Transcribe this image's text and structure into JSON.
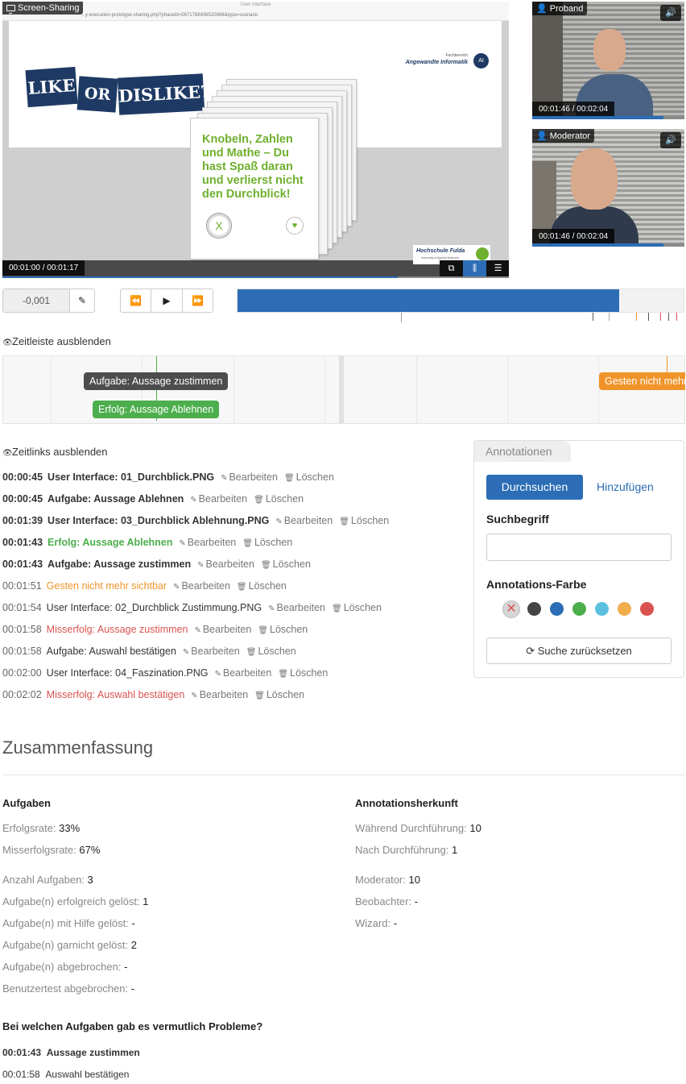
{
  "screen_share": {
    "label": "Screen-Sharing",
    "window_title": "User Interface",
    "url": "...y-execution-prototype-sharing.php?phaseId=5671788436520968&type=scenario",
    "slide": {
      "banner_like": "LIKE",
      "banner_or": "OR",
      "banner_dislike": "DISLIKE?",
      "logo_small": "Fachbereich",
      "logo_name": "Angewandte Informatik",
      "logo_badge": "AI",
      "card_text": "Knobeln, Zahlen und Mathe – Du hast Spaß daran und verlierst nicht den Durchblick!",
      "card_x": "X",
      "card_heart": "♥",
      "uni_name": "Hochschule Fulda",
      "uni_sub": "University of Applied Sciences"
    },
    "time": "00:01:00 / 00:01:17",
    "progress": 0.78,
    "layout_buttons": [
      "⧉",
      "⫼",
      "☰"
    ]
  },
  "cams": [
    {
      "label": "Proband",
      "time": "00:01:46 / 00:02:04",
      "sound": "🔊",
      "progress": 0.86
    },
    {
      "label": "Moderator",
      "time": "00:01:46 / 00:02:04",
      "sound": "🔊",
      "progress": 0.86
    }
  ],
  "controls": {
    "offset_value": "-0,001",
    "edit_icon": "✎",
    "rewind": "⏪",
    "play": "▶",
    "forward": "⏩",
    "timeline_progress": 0.853
  },
  "timeline": {
    "toggle_label": "Zeitleiste ausblenden",
    "tags": [
      {
        "label": "Aufgabe: Aussage zustimmen",
        "color": "#4d4d4d"
      },
      {
        "label": "Erfolg: Aussage Ablehnen",
        "color": "#4cae4c"
      },
      {
        "label": "Gesten nicht mehr sichtbar",
        "color": "#f0942a"
      }
    ]
  },
  "links": {
    "toggle_label": "Zeitlinks ausblenden",
    "edit_label": "Bearbeiten",
    "delete_label": "Löschen",
    "items": [
      {
        "time": "00:00:45",
        "label": "User Interface: 01_Durchblick.PNG",
        "color": "#333333",
        "bold": true
      },
      {
        "time": "00:00:45",
        "label": "Aufgabe: Aussage Ablehnen",
        "color": "#333333",
        "bold": true
      },
      {
        "time": "00:01:39",
        "label": "User Interface: 03_Durchblick Ablehnung.PNG",
        "color": "#333333",
        "bold": true
      },
      {
        "time": "00:01:43",
        "label": "Erfolg: Aussage Ablehnen",
        "color": "#4cae4c",
        "bold": true
      },
      {
        "time": "00:01:43",
        "label": "Aufgabe: Aussage zustimmen",
        "color": "#333333",
        "bold": true
      },
      {
        "time": "00:01:51",
        "label": "Gesten nicht mehr sichtbar",
        "color": "#f0942a",
        "bold": false
      },
      {
        "time": "00:01:54",
        "label": "User Interface: 02_Durchblick Zustimmung.PNG",
        "color": "#333333",
        "bold": false
      },
      {
        "time": "00:01:58",
        "label": "Misserfolg: Aussage zustimmen",
        "color": "#d9534f",
        "bold": false
      },
      {
        "time": "00:01:58",
        "label": "Aufgabe: Auswahl bestätigen",
        "color": "#333333",
        "bold": false
      },
      {
        "time": "00:02:00",
        "label": "User Interface: 04_Faszination.PNG",
        "color": "#333333",
        "bold": false
      },
      {
        "time": "00:02:02",
        "label": "Misserfolg: Auswahl bestätigen",
        "color": "#d9534f",
        "bold": false
      }
    ]
  },
  "annotations_panel": {
    "tab": "Annotationen",
    "search_button": "Durchsuchen",
    "add_button": "Hinzufügen",
    "search_label": "Suchbegriff",
    "search_value": "",
    "color_label": "Annotations-Farbe",
    "colors": [
      "#444444",
      "#2c6db5",
      "#4cae4c",
      "#5bc0de",
      "#f0ad4e",
      "#d9534f"
    ],
    "reset_button": "Suche zurücksetzen"
  },
  "summary": {
    "title": "Zusammenfassung",
    "tasks_heading": "Aufgaben",
    "success_rate_label": "Erfolgsrate:",
    "success_rate": "33%",
    "fail_rate_label": "Misserfolgsrate:",
    "fail_rate": "67%",
    "count_label": "Anzahl Aufgaben:",
    "count": "3",
    "solved_label": "Aufgabe(n) erfolgreich gelöst:",
    "solved": "1",
    "help_label": "Aufgabe(n) mit Hilfe gelöst:",
    "help": "-",
    "notsolved_label": "Aufgabe(n) garnicht gelöst:",
    "notsolved": "2",
    "aborted_label": "Aufgabe(n) abgebrochen:",
    "aborted": "-",
    "test_aborted_label": "Benutzertest abgebrochen:",
    "test_aborted": "-",
    "origin_heading": "Annotationsherkunft",
    "during_label": "Während Durchführung:",
    "during": "10",
    "after_label": "Nach Durchführung:",
    "after": "1",
    "moderator_label": "Moderator:",
    "moderator": "10",
    "observer_label": "Beobachter:",
    "observer": "-",
    "wizard_label": "Wizard:",
    "wizard": "-",
    "problems_heading": "Bei welchen Aufgaben gab es vermutlich Probleme?",
    "problems": [
      {
        "time": "00:01:43",
        "label": "Aussage zustimmen"
      },
      {
        "time": "00:01:58",
        "label": "Auswahl bestätigen"
      }
    ]
  }
}
